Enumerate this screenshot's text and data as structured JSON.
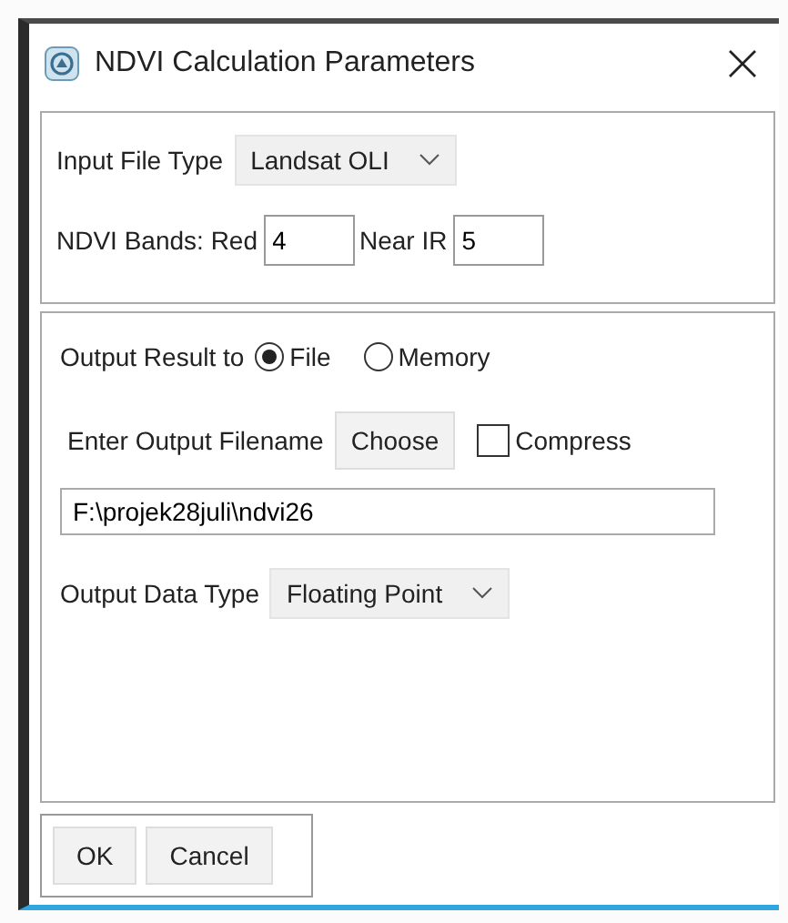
{
  "window": {
    "title": "NDVI Calculation Parameters"
  },
  "input_file_type": {
    "label": "Input File Type",
    "value": "Landsat OLI"
  },
  "bands": {
    "label": "NDVI Bands: Red",
    "red": "4",
    "near_ir_label": "Near IR",
    "near_ir": "5"
  },
  "output_result": {
    "label": "Output Result to",
    "options": [
      {
        "label": "File",
        "selected": true
      },
      {
        "label": "Memory",
        "selected": false
      }
    ]
  },
  "output_filename": {
    "label": "Enter Output Filename",
    "button": "Choose",
    "compress": {
      "label": "Compress",
      "checked": false
    },
    "value": "F:\\projek28juli\\ndvi26"
  },
  "output_data_type": {
    "label": "Output Data Type",
    "value": "Floating Point"
  },
  "buttons": [
    "OK",
    "Cancel"
  ]
}
